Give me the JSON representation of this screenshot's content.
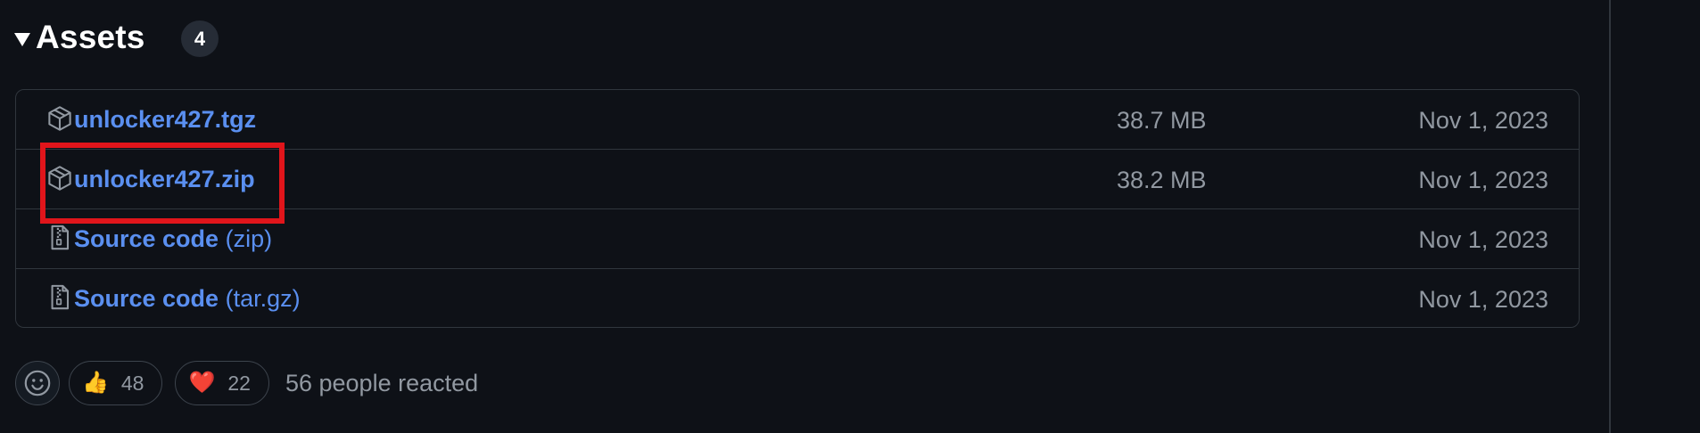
{
  "assets": {
    "title": "Assets",
    "count": "4",
    "items": [
      {
        "name": "unlocker427.tgz",
        "suffix": "",
        "size": "38.7 MB",
        "date": "Nov 1, 2023",
        "icon": "package-icon"
      },
      {
        "name": "unlocker427.zip",
        "suffix": "",
        "size": "38.2 MB",
        "date": "Nov 1, 2023",
        "icon": "package-icon"
      },
      {
        "name": "Source code",
        "suffix": "(zip)",
        "size": "",
        "date": "Nov 1, 2023",
        "icon": "file-zip-icon"
      },
      {
        "name": "Source code",
        "suffix": "(tar.gz)",
        "size": "",
        "date": "Nov 1, 2023",
        "icon": "file-zip-icon"
      }
    ]
  },
  "reactions": {
    "picker_icon": "smiley-icon",
    "items": [
      {
        "emoji": "👍",
        "count": "48",
        "icon": "thumbs-up-icon"
      },
      {
        "emoji": "❤️",
        "count": "22",
        "icon": "heart-icon"
      }
    ],
    "summary": "56 people reacted"
  },
  "colors": {
    "background": "#0d1117",
    "border": "#30363d",
    "link": "#5a8ff0",
    "muted": "#9198a1",
    "highlight": "#e0151b"
  }
}
